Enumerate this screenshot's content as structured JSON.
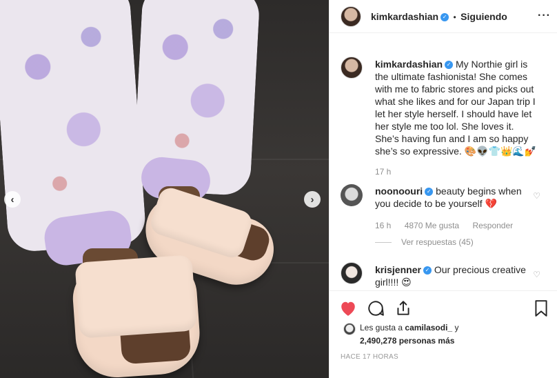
{
  "post": {
    "username": "kimkardashian",
    "separator": "•",
    "follow_status": "Siguiendo",
    "more_icon": "more-icon",
    "verified_icon": "verified-badge-icon"
  },
  "photo": {
    "prev_icon": "chevron-left-icon",
    "next_icon": "chevron-right-icon",
    "prev_glyph": "‹",
    "next_glyph": "›"
  },
  "caption": {
    "username": "kimkardashian",
    "text": "My Northie girl is the ultimate fashionista! She comes with me to fabric stores and picks out what she likes and for our Japan trip I let her style herself. I should have let her style me too lol. She loves it. She’s having fun and I am so happy she’s so expressive. 🎨👽👕👑🌊💅",
    "time": "17 h"
  },
  "comments": [
    {
      "username": "noonoouri",
      "text": "beauty begins when you decide to be yourself 💔",
      "time": "16 h",
      "likes": "4870 Me gusta",
      "reply": "Responder",
      "view_replies": "Ver respuestas (45)"
    },
    {
      "username": "krisjenner",
      "text": "Our precious creative girl!!!! 😍"
    }
  ],
  "actions": {
    "like_icon": "heart-filled-icon",
    "comment_icon": "comment-icon",
    "share_icon": "share-icon",
    "save_icon": "bookmark-icon"
  },
  "likes": {
    "prefix": "Les gusta a",
    "user": "camilasodi_",
    "and": "y",
    "count": "2,490,278 personas más"
  },
  "timestamp": "HACE 17 HORAS",
  "colors": {
    "verified": "#3897f0",
    "like": "#ed4956",
    "text": "#262626",
    "muted": "#8e8e8e"
  }
}
